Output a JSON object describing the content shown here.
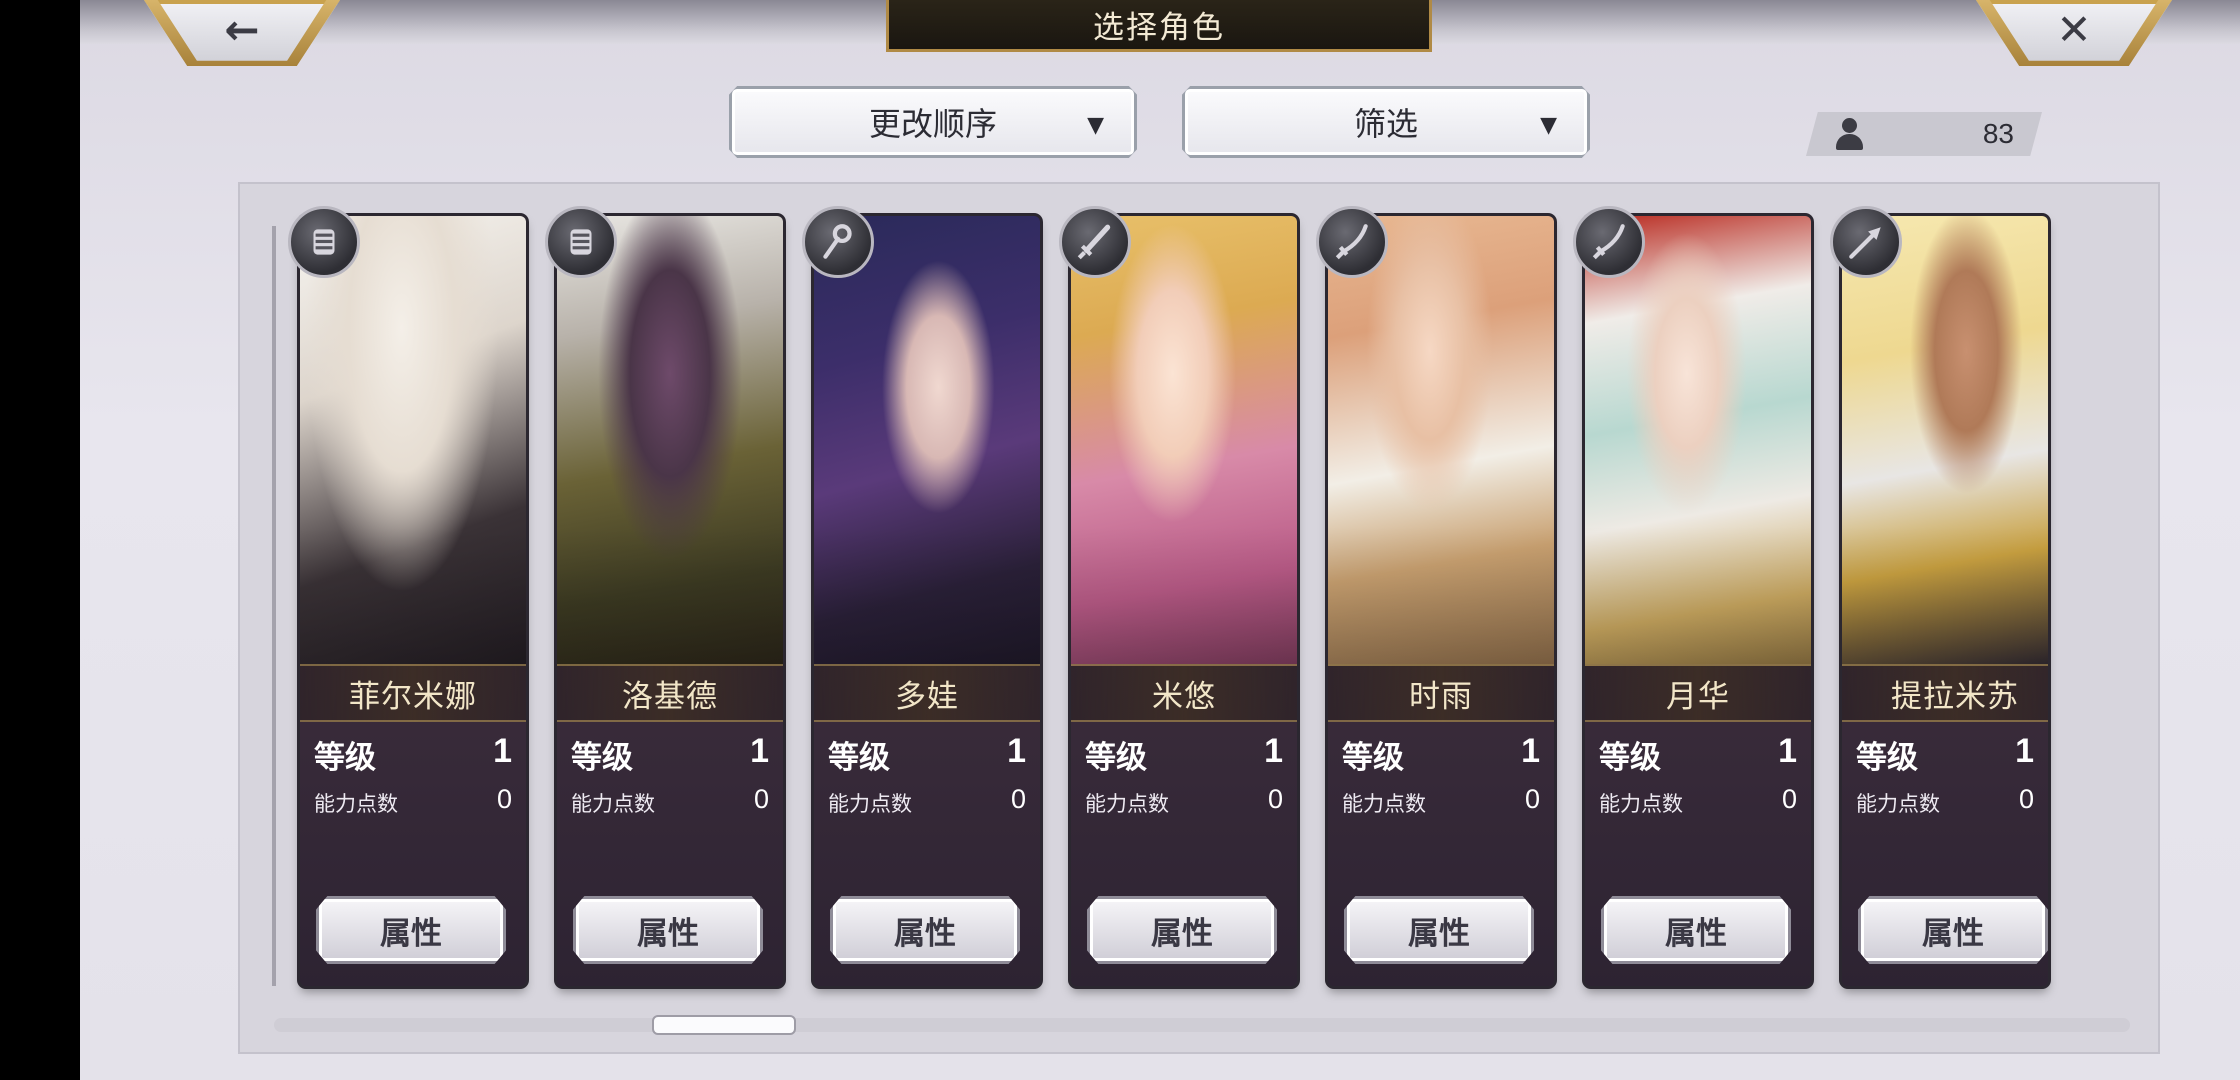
{
  "header": {
    "title": "选择角色",
    "back_glyph": "←",
    "close_glyph": "✕"
  },
  "controls": {
    "sort_label": "更改顺序",
    "filter_label": "筛选",
    "caret": "▼"
  },
  "roster_count": "83",
  "labels": {
    "level": "等级",
    "ability_points": "能力点数",
    "attributes": "属性"
  },
  "characters": [
    {
      "name": "菲尔米娜",
      "level": "1",
      "ability_points": "0",
      "weapon_icon": "gauntlet-icon"
    },
    {
      "name": "洛基德",
      "level": "1",
      "ability_points": "0",
      "weapon_icon": "gauntlet-icon"
    },
    {
      "name": "多娃",
      "level": "1",
      "ability_points": "0",
      "weapon_icon": "staff-icon"
    },
    {
      "name": "米悠",
      "level": "1",
      "ability_points": "0",
      "weapon_icon": "sword-icon"
    },
    {
      "name": "时雨",
      "level": "1",
      "ability_points": "0",
      "weapon_icon": "katana-icon"
    },
    {
      "name": "月华",
      "level": "1",
      "ability_points": "0",
      "weapon_icon": "katana-icon"
    },
    {
      "name": "提拉米苏",
      "level": "1",
      "ability_points": "0",
      "weapon_icon": "spear-icon"
    }
  ],
  "colors": {
    "gold_accent": "#c9a24e",
    "title_plate": "#1a1610",
    "panel_bg": "#d7d5dd"
  }
}
